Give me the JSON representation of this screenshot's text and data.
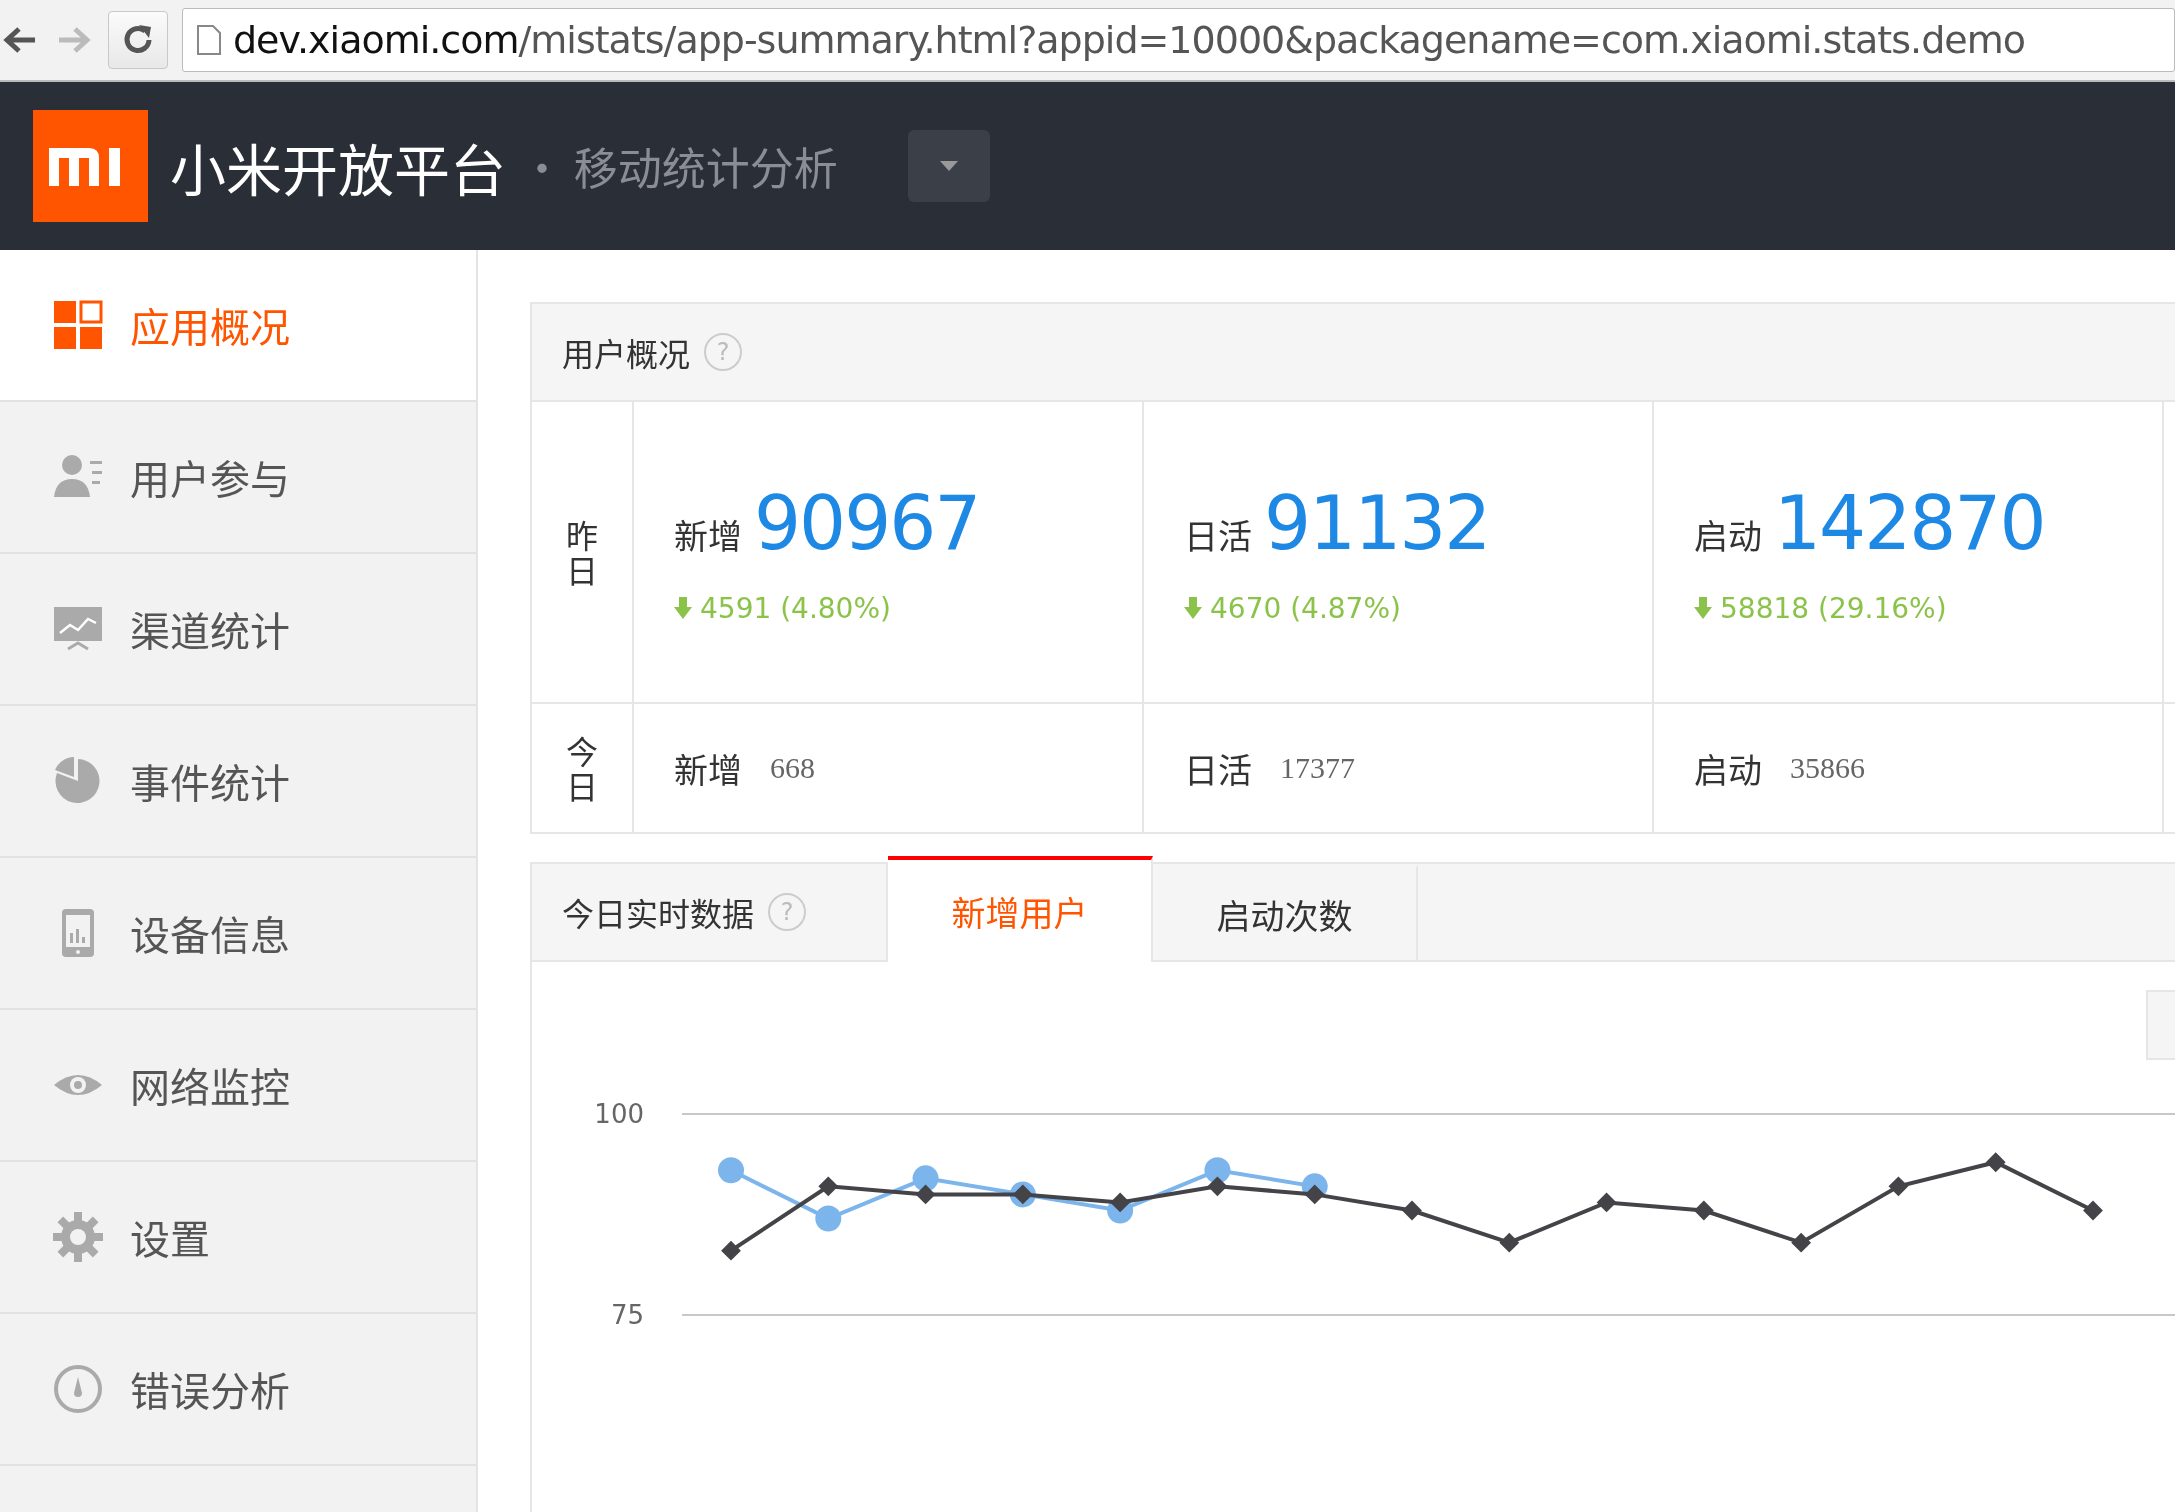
{
  "browser": {
    "url_host": "dev.xiaomi.com",
    "url_path": "/mistats/app-summary.html?appid=10000&packagename=com.xiaomi.stats.demo"
  },
  "header": {
    "title": "小米开放平台",
    "subtitle": "· 移动统计分析"
  },
  "sidebar": {
    "items": [
      {
        "label": "应用概况",
        "selected": true
      },
      {
        "label": "用户参与",
        "selected": false
      },
      {
        "label": "渠道统计",
        "selected": false
      },
      {
        "label": "事件统计",
        "selected": false
      },
      {
        "label": "设备信息",
        "selected": false
      },
      {
        "label": "网络监控",
        "selected": false
      },
      {
        "label": "设置",
        "selected": false
      },
      {
        "label": "错误分析",
        "selected": false
      }
    ]
  },
  "overview": {
    "title": "用户概况",
    "help": "?",
    "yesterday": {
      "label": "昨日",
      "metrics": [
        {
          "label": "新增",
          "value": "90967",
          "change": "4591 (4.80%)",
          "falling": true
        },
        {
          "label": "日活",
          "value": "91132",
          "change": "4670 (4.87%)",
          "falling": true
        },
        {
          "label": "启动",
          "value": "142870",
          "change": "58818 (29.16%)",
          "falling": true
        }
      ]
    },
    "today": {
      "label": "今日",
      "metrics": [
        {
          "label": "新增",
          "value": "668"
        },
        {
          "label": "日活",
          "value": "17377"
        },
        {
          "label": "启动",
          "value": "35866"
        }
      ]
    }
  },
  "realtime": {
    "title": "今日实时数据",
    "help": "?",
    "tabs": [
      {
        "label": "新增用户",
        "selected": true
      },
      {
        "label": "启动次数",
        "selected": false
      }
    ],
    "chart_data": {
      "type": "line",
      "categories": [
        null,
        null,
        null,
        null,
        null,
        null,
        null,
        null,
        null,
        null,
        null,
        null,
        null,
        null,
        null
      ],
      "ylim": [
        75,
        100
      ],
      "yticks": [
        {
          "value": 75,
          "label": "75"
        },
        {
          "value": 100,
          "label": "100"
        }
      ],
      "series": [
        {
          "color": "#7cb5ec",
          "marker": "circle",
          "values": [
            93,
            87,
            92,
            90,
            88,
            93,
            91,
            null,
            null,
            null,
            null,
            null,
            null,
            null,
            null
          ]
        },
        {
          "color": "#434348",
          "marker": "diamond",
          "values": [
            83,
            91,
            90,
            90,
            89,
            91,
            90,
            88,
            84,
            89,
            88,
            84,
            91,
            94,
            88
          ]
        }
      ]
    }
  }
}
